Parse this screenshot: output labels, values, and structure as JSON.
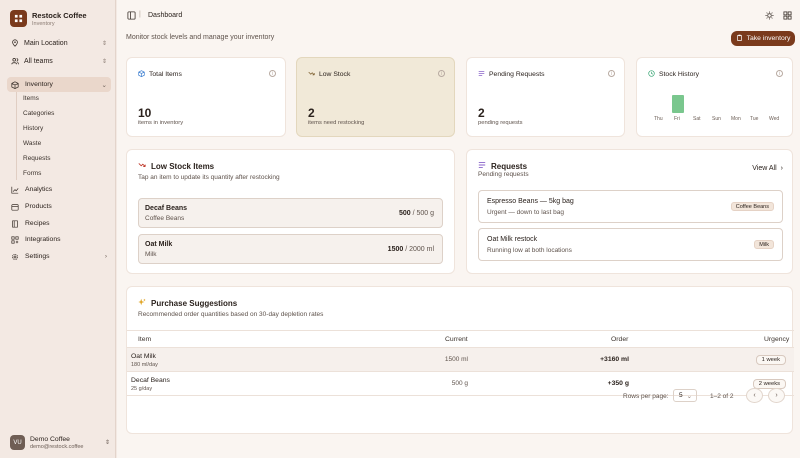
{
  "sidebar": {
    "brand_name": "Restock Coffee",
    "brand_sub": "Inventory",
    "location": "Main Location",
    "team": "All teams",
    "nav": {
      "inventory": "Inventory",
      "sub": [
        "Items",
        "Categories",
        "History",
        "Waste",
        "Requests",
        "Forms"
      ],
      "analytics": "Analytics",
      "products": "Products",
      "recipes": "Recipes",
      "integrations": "Integrations",
      "settings": "Settings"
    },
    "user": {
      "initials": "VU",
      "name": "Demo Coffee",
      "email": "demo@restock.coffee"
    }
  },
  "header": {
    "breadcrumb": "Dashboard",
    "subtitle": "Monitor stock levels and manage your inventory",
    "take_inventory": "Take inventory"
  },
  "stats": {
    "total": {
      "title": "Total Items",
      "value": "10",
      "caption": "items in inventory"
    },
    "low": {
      "title": "Low Stock",
      "value": "2",
      "caption": "items need restocking"
    },
    "pending": {
      "title": "Pending Requests",
      "value": "2",
      "caption": "pending requests"
    },
    "history": {
      "title": "Stock History",
      "days": [
        "Thu",
        "Fri",
        "Sat",
        "Sun",
        "Mon",
        "Tue",
        "Wed"
      ]
    }
  },
  "low_stock": {
    "title": "Low Stock Items",
    "subtitle": "Tap an item to update its quantity after restocking",
    "items": [
      {
        "name": "Decaf Beans",
        "category": "Coffee Beans",
        "current": "500",
        "total": "/ 500 g"
      },
      {
        "name": "Oat Milk",
        "category": "Milk",
        "current": "1500",
        "total": "/ 2000 ml"
      }
    ]
  },
  "requests": {
    "title": "Requests",
    "subtitle": "Pending requests",
    "view_all": "View All",
    "items": [
      {
        "title": "Espresso Beans — 5kg bag",
        "desc": "Urgent — down to last bag",
        "tag": "Coffee Beans"
      },
      {
        "title": "Oat Milk restock",
        "desc": "Running low at both locations",
        "tag": "Milk"
      }
    ]
  },
  "suggestions": {
    "title": "Purchase Suggestions",
    "subtitle": "Recommended order quantities based on 30-day depletion rates",
    "columns": {
      "item": "Item",
      "current": "Current",
      "order": "Order",
      "urgency": "Urgency"
    },
    "rows": [
      {
        "name": "Oat Milk",
        "rate": "180 ml/day",
        "current": "1500 ml",
        "order": "+3160 ml",
        "urgency": "1 week"
      },
      {
        "name": "Decaf Beans",
        "rate": "25 g/day",
        "current": "500 g",
        "order": "+350 g",
        "urgency": "2 weeks"
      }
    ],
    "pager": {
      "label": "Rows per page:",
      "size": "5",
      "info": "1–2 of 2"
    }
  },
  "colors": {
    "accent": "#7a3a1c",
    "highlight_card": "#f1e9d8",
    "history_bar": "#7ac78e"
  }
}
